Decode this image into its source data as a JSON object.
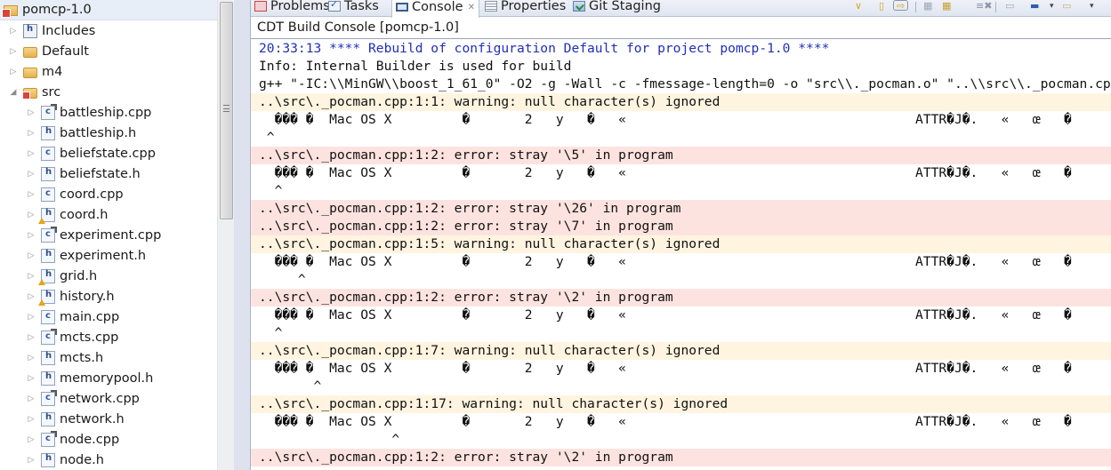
{
  "explorer": {
    "project": {
      "label": "pomcp-1.0",
      "icon": "c-project-icon"
    },
    "items": [
      {
        "label": "Includes",
        "icon": "includes-icon",
        "expanded": false,
        "level": 1
      },
      {
        "label": "Default",
        "icon": "folder-icon",
        "expanded": false,
        "level": 1
      },
      {
        "label": "m4",
        "icon": "folder-icon",
        "expanded": false,
        "level": 1
      },
      {
        "label": "src",
        "icon": "source-folder-icon",
        "expanded": true,
        "level": 1
      },
      {
        "label": "battleship.cpp",
        "icon": "cpp-file-modified-icon",
        "level": 2
      },
      {
        "label": "battleship.h",
        "icon": "header-file-icon",
        "level": 2
      },
      {
        "label": "beliefstate.cpp",
        "icon": "cpp-file-icon",
        "level": 2
      },
      {
        "label": "beliefstate.h",
        "icon": "header-file-icon",
        "level": 2
      },
      {
        "label": "coord.cpp",
        "icon": "cpp-file-icon",
        "level": 2
      },
      {
        "label": "coord.h",
        "icon": "header-file-warning-icon",
        "level": 2
      },
      {
        "label": "experiment.cpp",
        "icon": "cpp-file-modified-icon",
        "level": 2
      },
      {
        "label": "experiment.h",
        "icon": "header-file-icon",
        "level": 2
      },
      {
        "label": "grid.h",
        "icon": "header-file-warning-icon",
        "level": 2
      },
      {
        "label": "history.h",
        "icon": "header-file-warning-icon",
        "level": 2
      },
      {
        "label": "main.cpp",
        "icon": "cpp-file-icon",
        "level": 2
      },
      {
        "label": "mcts.cpp",
        "icon": "cpp-file-modified-icon",
        "level": 2
      },
      {
        "label": "mcts.h",
        "icon": "header-file-icon",
        "level": 2
      },
      {
        "label": "memorypool.h",
        "icon": "header-file-icon",
        "level": 2
      },
      {
        "label": "network.cpp",
        "icon": "cpp-file-modified-icon",
        "level": 2
      },
      {
        "label": "network.h",
        "icon": "header-file-icon",
        "level": 2
      },
      {
        "label": "node.cpp",
        "icon": "cpp-file-modified-icon",
        "level": 2
      },
      {
        "label": "node.h",
        "icon": "header-file-icon",
        "level": 2
      }
    ]
  },
  "tabs": [
    {
      "label": "Problems",
      "icon": "problems-icon",
      "active": false
    },
    {
      "label": "Tasks",
      "icon": "tasks-icon",
      "active": false
    },
    {
      "label": "Console",
      "icon": "console-icon",
      "active": true,
      "close": "✕"
    },
    {
      "label": "Properties",
      "icon": "properties-icon",
      "active": false
    },
    {
      "label": "Git Staging",
      "icon": "git-staging-icon",
      "active": false
    }
  ],
  "toolbar": [
    {
      "name": "minimize-chevron-icon",
      "glyph": "∨"
    },
    {
      "name": "terminate-icon",
      "glyph": "▯"
    },
    {
      "name": "remove-launch-icon",
      "glyph": "⇨"
    },
    {
      "name": "scroll-lock-icon",
      "glyph": "▦"
    },
    {
      "name": "pin-console-icon",
      "glyph": "▦"
    },
    {
      "name": "clear-console-icon",
      "glyph": "≡✖"
    },
    {
      "name": "display-selected-console-icon",
      "glyph": "▭"
    },
    {
      "name": "open-console-icon",
      "glyph": "▬"
    },
    {
      "name": "open-console-dropdown-icon",
      "glyph": "▾"
    },
    {
      "name": "new-console-view-icon",
      "glyph": "▭"
    },
    {
      "name": "view-menu-icon",
      "glyph": "▾"
    }
  ],
  "console": {
    "title": "CDT Build Console [pomcp-1.0]",
    "lines": [
      {
        "type": "info-blue",
        "text": "20:33:13 **** Rebuild of configuration Default for project pomcp-1.0 ****"
      },
      {
        "type": "plain",
        "text": "Info: Internal Builder is used for build"
      },
      {
        "type": "plain",
        "text": "g++ \"-IC:\\\\MinGW\\\\boost_1_61_0\" -O2 -g -Wall -c -fmessage-length=0 -o \"src\\\\._pocman.o\" \"..\\\\src\\\\._pocman.cpp\""
      },
      {
        "type": "warning",
        "text": "..\\src\\._pocman.cpp:1:1: warning: null character(s) ignored"
      },
      {
        "type": "plain",
        "text": "  ��� �  Mac OS X         �       2   y   �   «                                     ATTR�J�.   «   œ   �"
      },
      {
        "type": "plain",
        "text": " ^"
      },
      {
        "type": "error",
        "text": "..\\src\\._pocman.cpp:1:2: error: stray '\\5' in program"
      },
      {
        "type": "plain",
        "text": "  ��� �  Mac OS X         �       2   y   �   «                                     ATTR�J�.   «   œ   �"
      },
      {
        "type": "plain",
        "text": "  ^"
      },
      {
        "type": "error",
        "text": "..\\src\\._pocman.cpp:1:2: error: stray '\\26' in program"
      },
      {
        "type": "error",
        "text": "..\\src\\._pocman.cpp:1:2: error: stray '\\7' in program"
      },
      {
        "type": "warning",
        "text": "..\\src\\._pocman.cpp:1:5: warning: null character(s) ignored"
      },
      {
        "type": "plain",
        "text": "  ��� �  Mac OS X         �       2   y   �   «                                     ATTR�J�.   «   œ   �"
      },
      {
        "type": "plain",
        "text": "     ^"
      },
      {
        "type": "error",
        "text": "..\\src\\._pocman.cpp:1:2: error: stray '\\2' in program"
      },
      {
        "type": "plain",
        "text": "  ��� �  Mac OS X         �       2   y   �   «                                     ATTR�J�.   «   œ   �"
      },
      {
        "type": "plain",
        "text": "  ^"
      },
      {
        "type": "warning",
        "text": "..\\src\\._pocman.cpp:1:7: warning: null character(s) ignored"
      },
      {
        "type": "plain",
        "text": "  ��� �  Mac OS X         �       2   y   �   «                                     ATTR�J�.   «   œ   �"
      },
      {
        "type": "plain",
        "text": "       ^"
      },
      {
        "type": "warning",
        "text": "..\\src\\._pocman.cpp:1:17: warning: null character(s) ignored"
      },
      {
        "type": "plain",
        "text": "  ��� �  Mac OS X         �       2   y   �   «                                     ATTR�J�.   «   œ   �"
      },
      {
        "type": "plain",
        "text": "                 ^"
      },
      {
        "type": "error",
        "text": "..\\src\\._pocman.cpp:1:2: error: stray '\\2' in program"
      }
    ]
  },
  "colors": {
    "warning_bg": "#fff4e0",
    "error_bg": "#fde3e0",
    "info_blue": "#1f2fb8"
  }
}
